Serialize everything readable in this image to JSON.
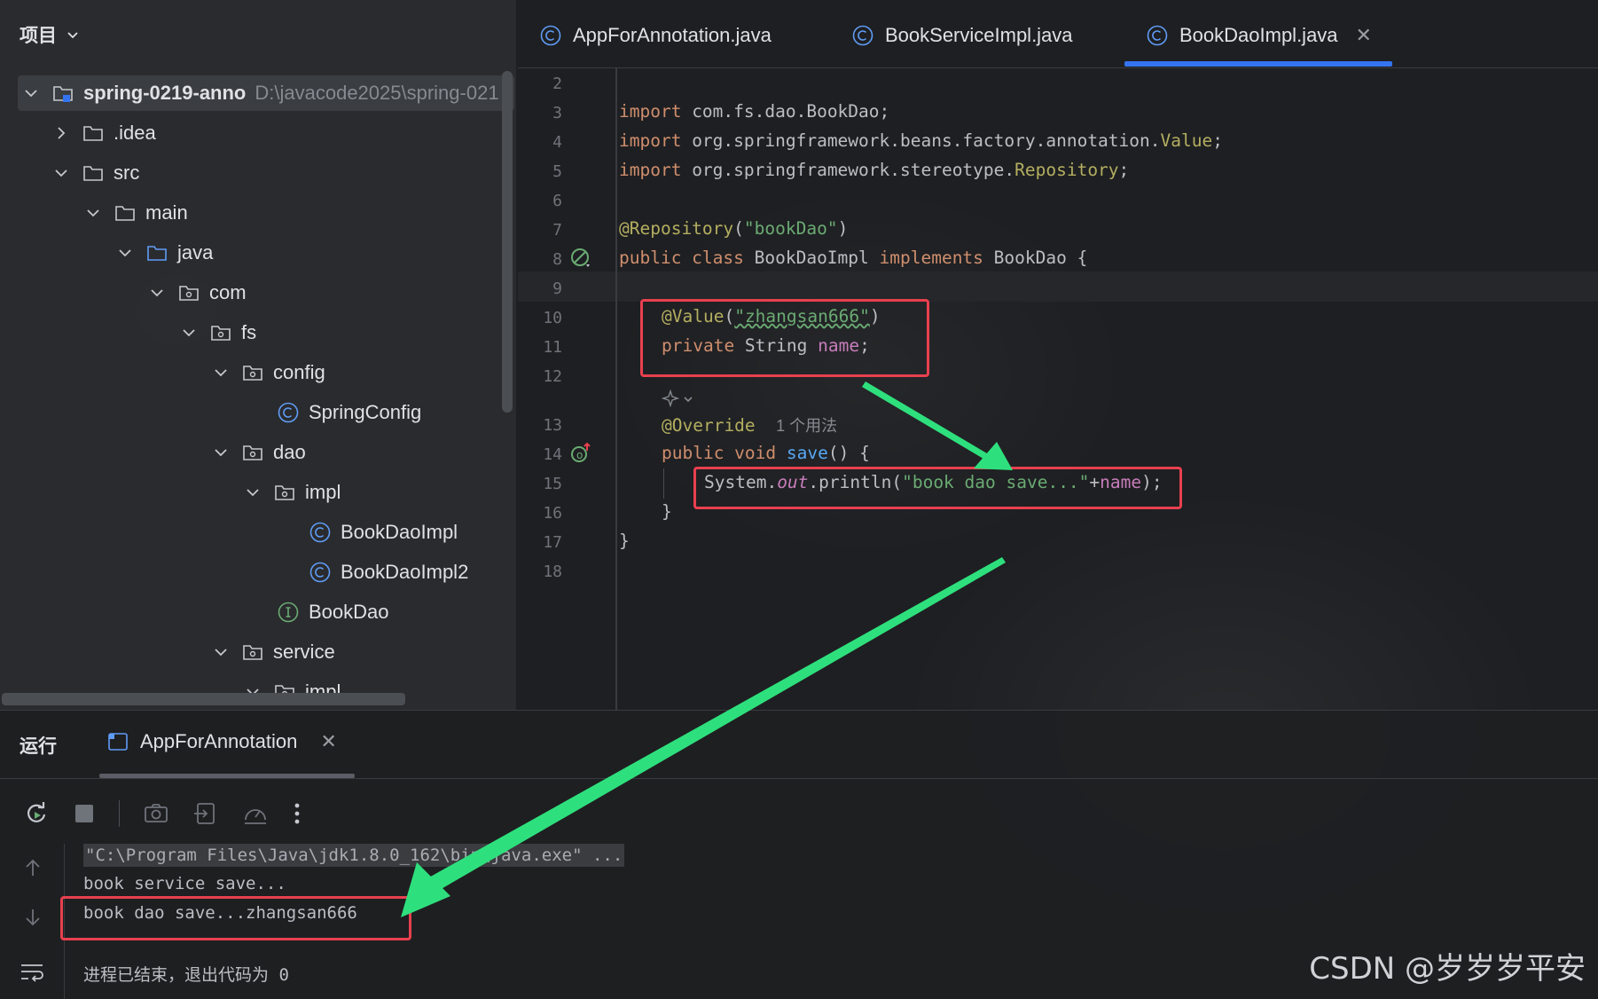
{
  "project": {
    "header": "项目",
    "root": {
      "name": "spring-0219-anno",
      "path": "D:\\javacode2025\\spring-021"
    },
    "items": [
      {
        "label": ".idea"
      },
      {
        "label": "src"
      },
      {
        "label": "main"
      },
      {
        "label": "java"
      },
      {
        "label": "com"
      },
      {
        "label": "fs"
      },
      {
        "label": "config"
      },
      {
        "label": "SpringConfig"
      },
      {
        "label": "dao"
      },
      {
        "label": "impl"
      },
      {
        "label": "BookDaoImpl"
      },
      {
        "label": "BookDaoImpl2"
      },
      {
        "label": "BookDao"
      },
      {
        "label": "service"
      },
      {
        "label": "impl"
      }
    ]
  },
  "editor": {
    "tabs": [
      {
        "label": "AppForAnnotation.java"
      },
      {
        "label": "BookServiceImpl.java"
      },
      {
        "label": "BookDaoImpl.java"
      }
    ],
    "active_tab_close": "✕",
    "line_numbers": [
      "2",
      "3",
      "4",
      "5",
      "6",
      "7",
      "8",
      "9",
      "10",
      "11",
      "12",
      "13",
      "14",
      "15",
      "16",
      "17",
      "18"
    ],
    "code": {
      "l3": {
        "kw": "import",
        "rest": " com.fs.dao.BookDao;"
      },
      "l4": {
        "kw": "import",
        "pre": " org.springframework.beans.factory.annotation.",
        "ann": "Value",
        "post": ";"
      },
      "l5": {
        "kw": "import",
        "pre": " org.springframework.stereotype.",
        "ann": "Repository",
        "post": ";"
      },
      "l7": {
        "ann": "@Repository",
        "open": "(",
        "str": "\"bookDao\"",
        "close": ")"
      },
      "l8": {
        "kw1": "public class",
        "mid": " BookDaoImpl ",
        "kw2": "implements",
        "post": " BookDao {"
      },
      "l10": {
        "ann": "@Value",
        "open": "(",
        "str": "\"zhangsan666\"",
        "close": ")"
      },
      "l11": {
        "kw": "private",
        "mid": " String ",
        "fld": "name",
        "post": ";"
      },
      "l13": {
        "ann": "@Override",
        "hint": "1 个用法"
      },
      "l14": {
        "kw": "public void",
        "fn": " save",
        "post": "() {"
      },
      "l15": {
        "pre": "System.",
        "it": "out",
        "mid": ".println(",
        "str": "\"book dao save...\"",
        "plus": "+",
        "fld": "name",
        "post": ");"
      },
      "l16": "}",
      "l17": "}"
    }
  },
  "run": {
    "title": "运行",
    "tab_label": "AppForAnnotation",
    "tab_close": "✕",
    "console": {
      "cmd": "\"C:\\Program Files\\Java\\jdk1.8.0_162\\bin\\java.exe\" ...",
      "line1": "book service save...",
      "line2": "book dao save...zhangsan666",
      "exit": "进程已结束，退出代码为 0"
    }
  },
  "watermark": "CSDN @岁岁岁平安",
  "colors": {
    "accent": "#3574f0",
    "highlight_box": "#e8404f",
    "arrow": "#2ee07d"
  }
}
